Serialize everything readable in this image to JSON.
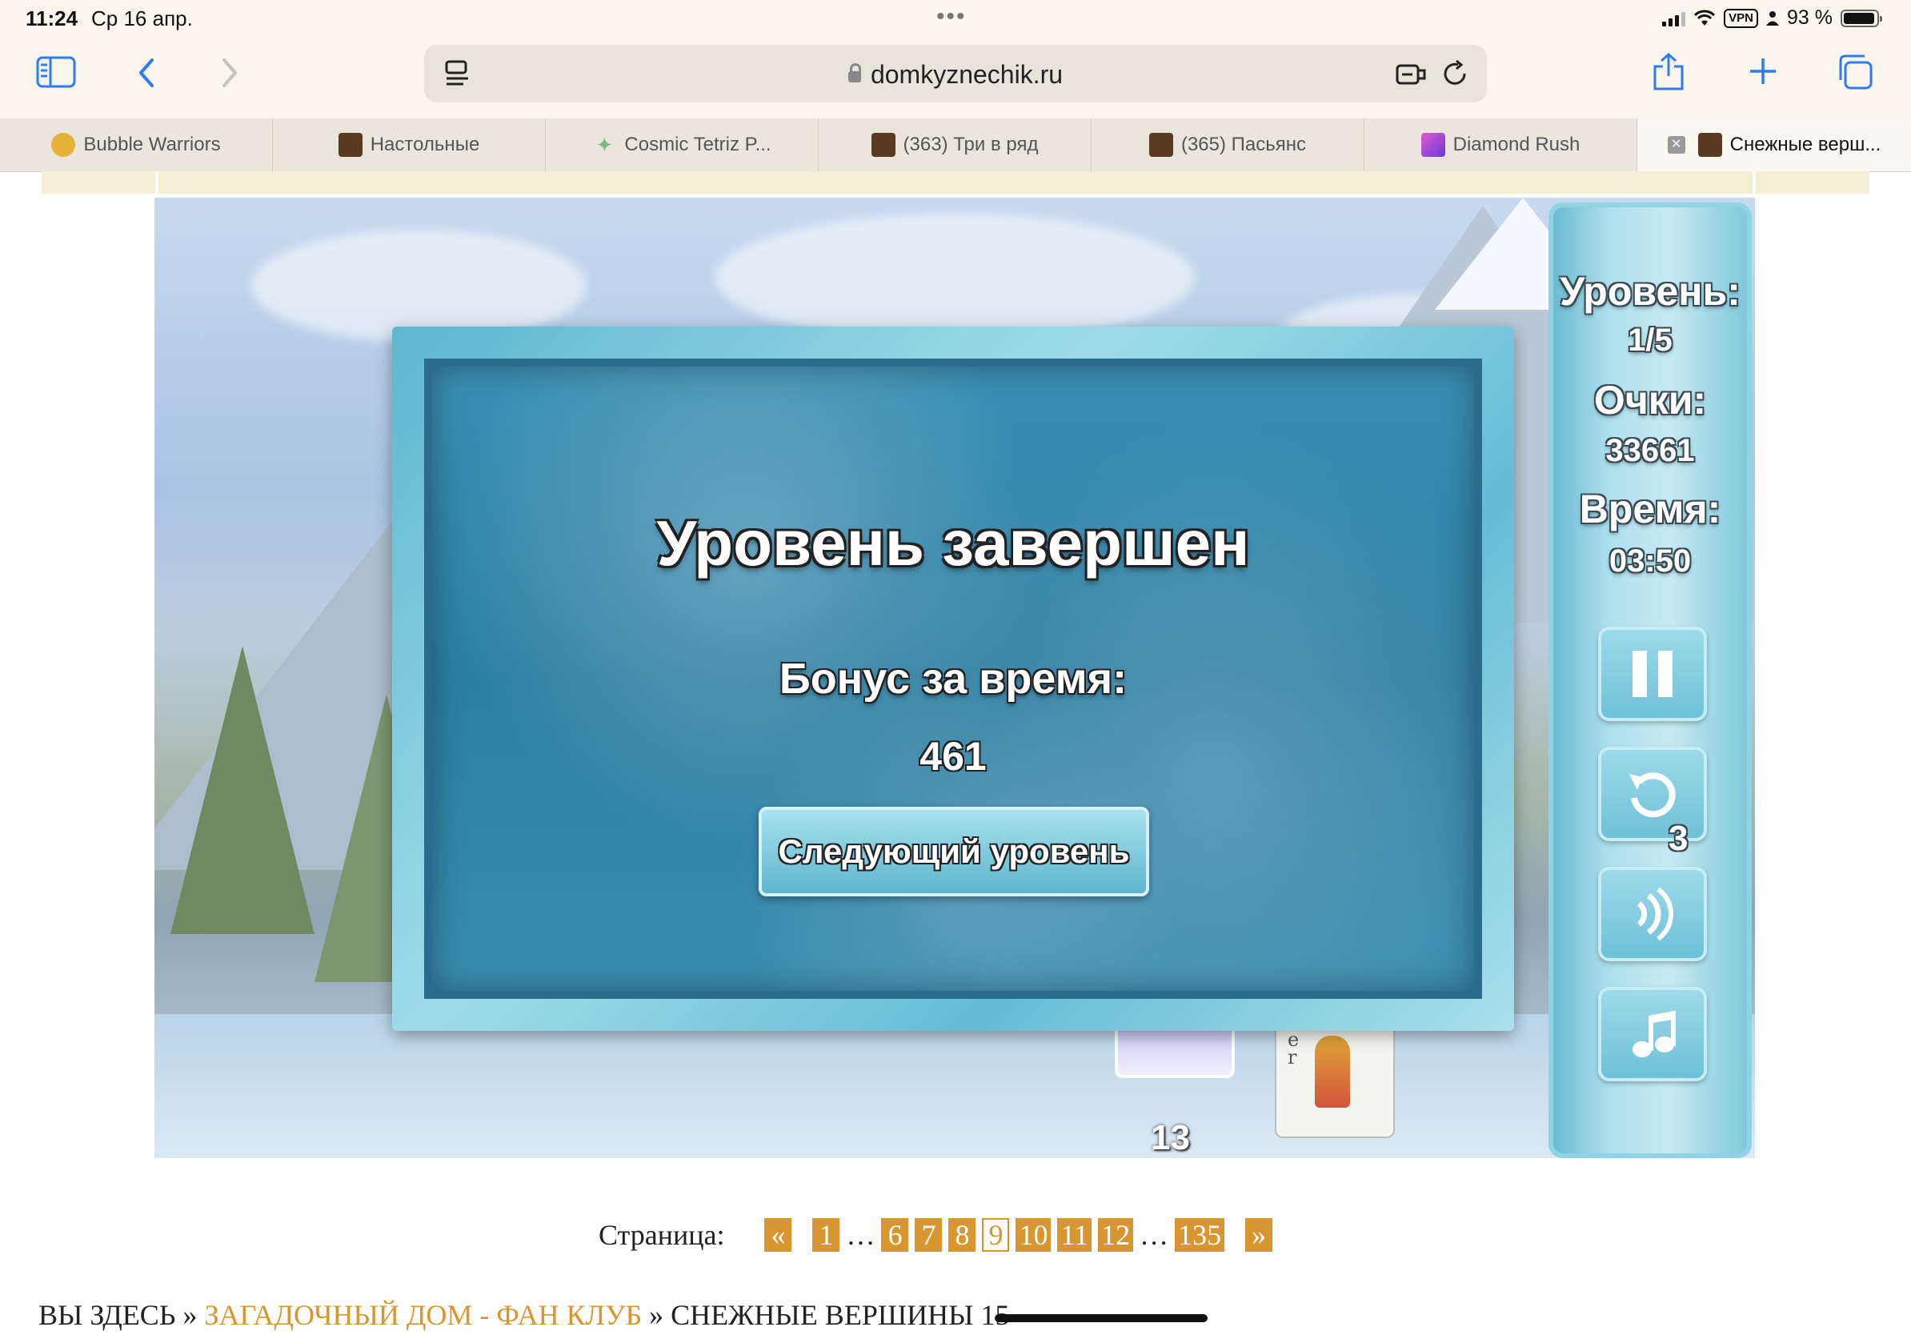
{
  "status_bar": {
    "time": "11:24",
    "date": "Ср 16 апр.",
    "vpn": "VPN",
    "battery": "93 %"
  },
  "toolbar": {
    "url": "domkyznechik.ru"
  },
  "tabs": [
    {
      "label": "Bubble Warriors",
      "favicon_color": "#e6b23a"
    },
    {
      "label": "Настольные",
      "favicon_color": "#5a3b22"
    },
    {
      "label": "Cosmic Tetriz P...",
      "favicon_color": "#9bd1a0"
    },
    {
      "label": "(363) Три в ряд",
      "favicon_color": "#5a3b22"
    },
    {
      "label": "(365) Пасьянс",
      "favicon_color": "#5a3b22"
    },
    {
      "label": "Diamond Rush",
      "favicon_color": "#b04ad6"
    },
    {
      "label": "Снежные верш...",
      "favicon_color": "#5a3b22",
      "active": true
    }
  ],
  "game": {
    "side_panel": {
      "level_label": "Уровень:",
      "level_value": "1/5",
      "score_label": "Очки:",
      "score_value": "33661",
      "time_label": "Время:",
      "time_value": "03:50",
      "restart_count": "3"
    },
    "deck_count": "13",
    "card_letters": "e\nr",
    "modal": {
      "title": "Уровень завершен",
      "bonus_label": "Бонус за время:",
      "bonus_value": "461",
      "next_button": "Следующий уровень"
    }
  },
  "pagination": {
    "label": "Страница:",
    "prev": "«",
    "next": "»",
    "pages": [
      "1",
      "…",
      "6",
      "7",
      "8",
      "9",
      "10",
      "11",
      "12",
      "…",
      "135"
    ],
    "current": "9"
  },
  "breadcrumb": {
    "prefix": "ВЫ ЗДЕСЬ",
    "sep": "»",
    "link": "ЗАГАДОЧНЫЙ ДОМ - ФАН КЛУБ",
    "current": "СНЕЖНЫЕ ВЕРШИНЫ 15"
  }
}
